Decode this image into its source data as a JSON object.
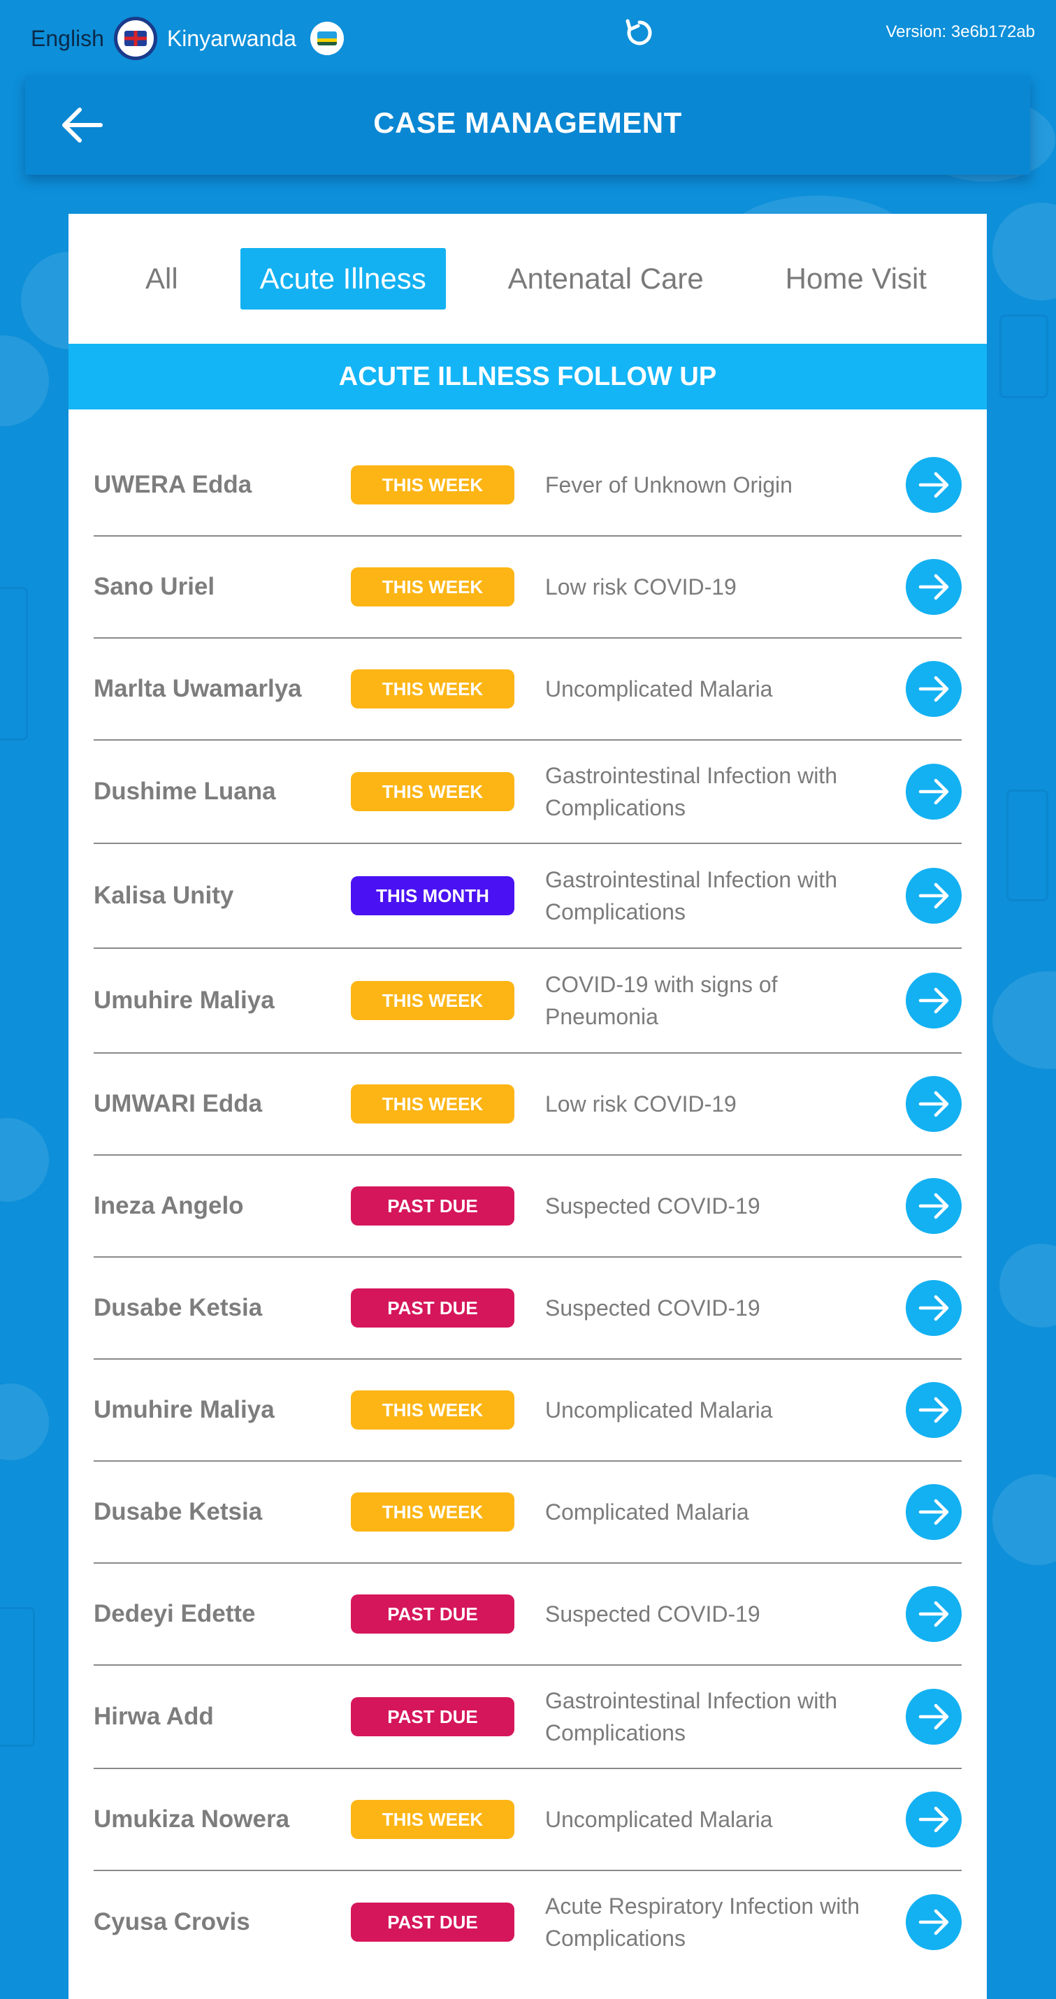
{
  "colors": {
    "background": "#0d8fd9",
    "header": "#0a87d3",
    "accent": "#13b1f2",
    "this_week": "#fdb515",
    "this_month": "#4a12f2",
    "past_due": "#d6165a",
    "text_grey": "#7b7b7b"
  },
  "topbar": {
    "lang_english": "English",
    "lang_english_flag_icon": "uk-flag-icon",
    "lang_kinyarwanda": "Kinyarwanda",
    "lang_kinyarwanda_flag_icon": "rwanda-flag-icon",
    "refresh_icon": "refresh-icon",
    "version": "Version: 3e6b172ab"
  },
  "header": {
    "back_icon": "arrow-left-icon",
    "title": "CASE MANAGEMENT"
  },
  "tabs": [
    {
      "label": "All",
      "active": false
    },
    {
      "label": "Acute Illness",
      "active": true
    },
    {
      "label": "Antenatal Care",
      "active": false
    },
    {
      "label": "Home Visit",
      "active": false
    }
  ],
  "section_title": "ACUTE ILLNESS FOLLOW UP",
  "rows": [
    {
      "name": "UWERA Edda",
      "due": "THIS WEEK",
      "status": "this_week",
      "diagnosis": "Fever of Unknown Origin"
    },
    {
      "name": "Sano Uriel",
      "due": "THIS WEEK",
      "status": "this_week",
      "diagnosis": "Low risk COVID-19"
    },
    {
      "name": "Marlta Uwamarlya",
      "due": "THIS WEEK",
      "status": "this_week",
      "diagnosis": "Uncomplicated Malaria"
    },
    {
      "name": "Dushime Luana",
      "due": "THIS WEEK",
      "status": "this_week",
      "diagnosis": "Gastrointestinal Infection with Complications"
    },
    {
      "name": "Kalisa Unity",
      "due": "THIS MONTH",
      "status": "this_month",
      "diagnosis": "Gastrointestinal Infection with Complications"
    },
    {
      "name": "Umuhire Maliya",
      "due": "THIS WEEK",
      "status": "this_week",
      "diagnosis": "COVID-19 with signs of Pneumonia"
    },
    {
      "name": "UMWARI Edda",
      "due": "THIS WEEK",
      "status": "this_week",
      "diagnosis": "Low risk COVID-19"
    },
    {
      "name": "Ineza Angelo",
      "due": "PAST DUE",
      "status": "past_due",
      "diagnosis": "Suspected COVID-19"
    },
    {
      "name": "Dusabe Ketsia",
      "due": "PAST DUE",
      "status": "past_due",
      "diagnosis": "Suspected COVID-19"
    },
    {
      "name": "Umuhire Maliya",
      "due": "THIS WEEK",
      "status": "this_week",
      "diagnosis": "Uncomplicated Malaria"
    },
    {
      "name": "Dusabe Ketsia",
      "due": "THIS WEEK",
      "status": "this_week",
      "diagnosis": "Complicated Malaria"
    },
    {
      "name": "Dedeyi Edette",
      "due": "PAST DUE",
      "status": "past_due",
      "diagnosis": "Suspected COVID-19"
    },
    {
      "name": "Hirwa Add",
      "due": "PAST DUE",
      "status": "past_due",
      "diagnosis": "Gastrointestinal Infection with Complications"
    },
    {
      "name": "Umukiza Nowera",
      "due": "THIS WEEK",
      "status": "this_week",
      "diagnosis": "Uncomplicated Malaria"
    },
    {
      "name": "Cyusa Crovis",
      "due": "PAST DUE",
      "status": "past_due",
      "diagnosis": "Acute Respiratory Infection with Complications"
    }
  ],
  "row_action_icon": "arrow-right-icon"
}
